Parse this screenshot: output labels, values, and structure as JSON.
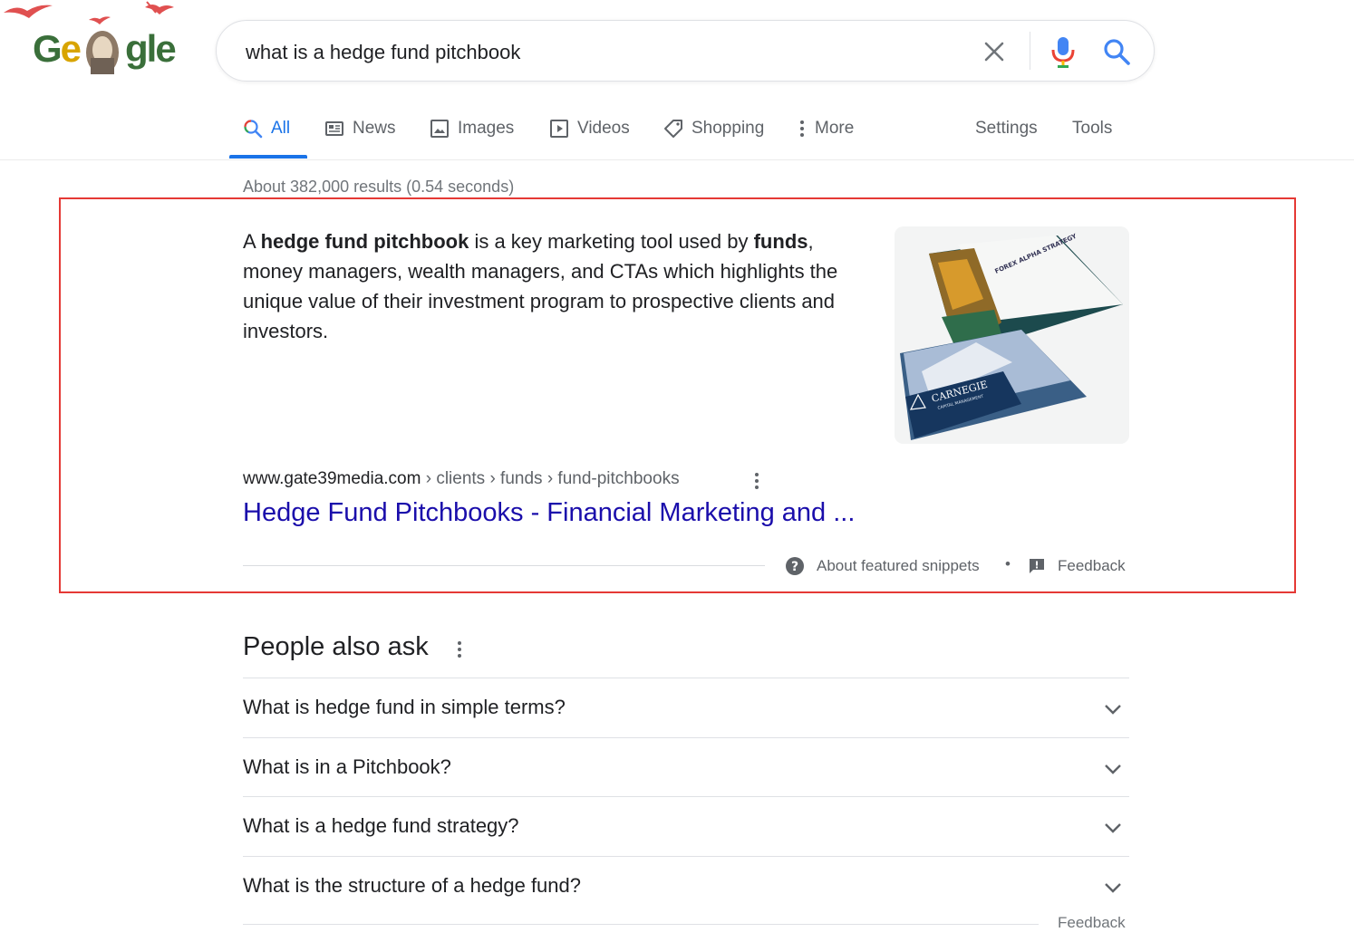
{
  "logo": {
    "text": "Google"
  },
  "search": {
    "query": "what is a hedge fund pitchbook"
  },
  "tabs": [
    {
      "label": "All",
      "icon": "search-icon"
    },
    {
      "label": "News",
      "icon": "news-icon"
    },
    {
      "label": "Images",
      "icon": "image-icon"
    },
    {
      "label": "Videos",
      "icon": "video-icon"
    },
    {
      "label": "Shopping",
      "icon": "tag-icon"
    },
    {
      "label": "More",
      "icon": "kebab-icon"
    },
    {
      "label": "Settings"
    },
    {
      "label": "Tools"
    }
  ],
  "active_tab": "All",
  "result_stats": "About 382,000 results (0.54 seconds)",
  "snippet": {
    "text_parts": [
      "A ",
      "hedge fund pitchbook",
      " is a key marketing tool used by ",
      "funds",
      ", money managers, wealth managers, and CTAs which highlights the unique value of their investment program to prospective clients and investors."
    ],
    "image": {
      "title": "FOREX ALPHA STRATEGY",
      "brand": "CARNEGIE",
      "brand_sub": "CAPITAL MANAGEMENT"
    },
    "breadcrumb_domain": "www.gate39media.com",
    "breadcrumb_path": " › clients › funds › fund-pitchbooks",
    "title": "Hedge Fund Pitchbooks - Financial Marketing and ...",
    "about_label": "About featured snippets",
    "separator": "•",
    "feedback_label": "Feedback"
  },
  "people_also_ask": {
    "title": "People also ask",
    "questions": [
      "What is hedge fund in simple terms?",
      "What is in a Pitchbook?",
      "What is a hedge fund strategy?",
      "What is the structure of a hedge fund?"
    ],
    "feedback_label": "Feedback"
  },
  "colors": {
    "link": "#1a0dab",
    "accent": "#1a73e8",
    "highlight": "#e53935"
  }
}
